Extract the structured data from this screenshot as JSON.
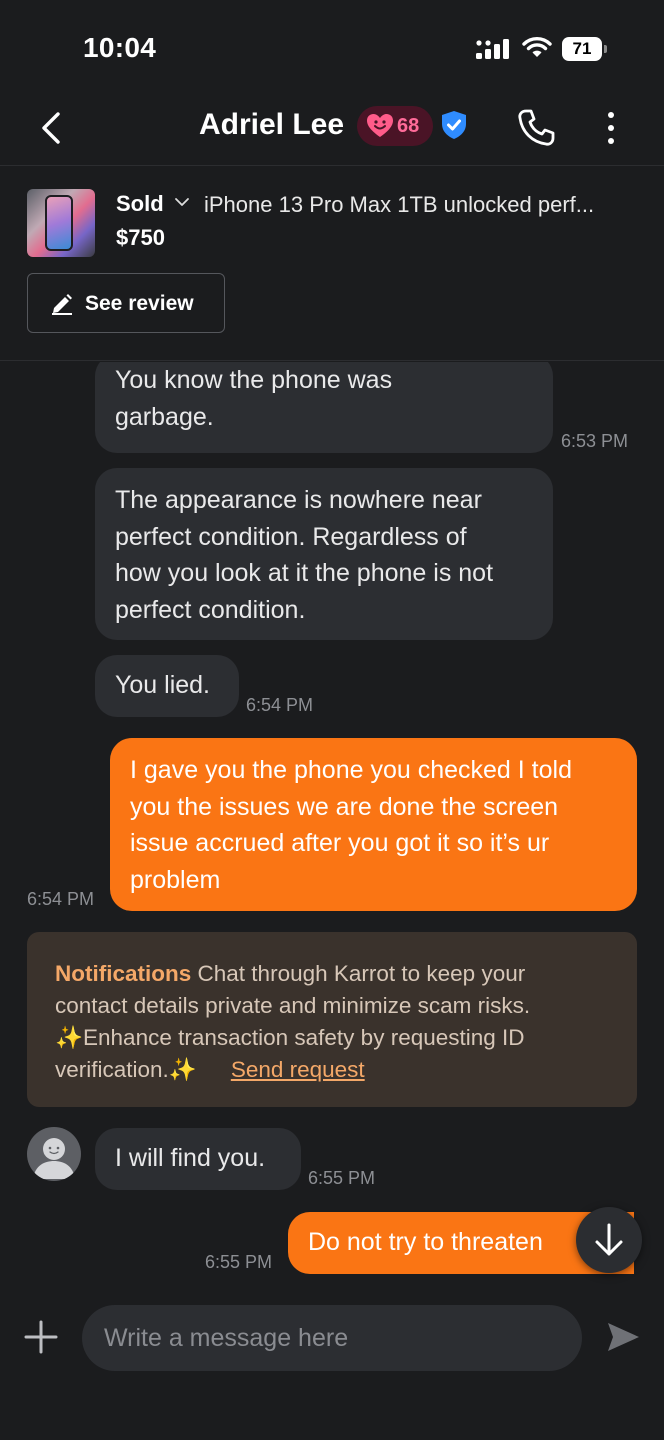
{
  "status_bar": {
    "time": "10:04",
    "battery": "71"
  },
  "header": {
    "title": "Adriel Lee",
    "manner_temp": "68"
  },
  "product": {
    "status": "Sold",
    "title": "iPhone 13 Pro Max 1TB unlocked perf...",
    "price": "$750",
    "review_button": "See review"
  },
  "messages": [
    {
      "side": "in",
      "text_lines": [
        "You know the phone was",
        "garbage."
      ],
      "time": "6:53 PM"
    },
    {
      "side": "in",
      "text_lines": [
        "The appearance is nowhere near",
        "perfect condition. Regardless of",
        "how you look at it the phone is not",
        "perfect condition."
      ]
    },
    {
      "side": "in",
      "text_lines": [
        "You lied."
      ],
      "time": "6:54 PM"
    },
    {
      "side": "out",
      "text_lines": [
        "I gave you the phone you checked I told",
        "you the issues we are done the screen",
        "issue accrued after you got it so it’s ur",
        "problem"
      ],
      "time": "6:54 PM"
    },
    {
      "side": "in",
      "text_lines": [
        "I will find you."
      ],
      "time": "6:55 PM"
    },
    {
      "side": "out",
      "text_lines": [
        "Do not try to threaten"
      ],
      "time": "6:55 PM"
    }
  ],
  "notice": {
    "heading": "Notifications",
    "line1": "Chat through Karrot to keep your",
    "line2": "contact details private and minimize scam risks.",
    "line3": "✨Enhance transaction safety by requesting ID",
    "line4": "verification.✨",
    "link": "Send request"
  },
  "composer": {
    "placeholder": "Write a message here"
  },
  "colors": {
    "background": "#1b1c1e",
    "incoming_bubble": "#2c2e32",
    "outgoing_bubble": "#fa7514",
    "notice_bg": "#3a322c",
    "notice_accent": "#f4a868",
    "manner_badge": "#4a1426",
    "verified": "#2f8cff"
  },
  "icons": [
    "back-icon",
    "heart-face-icon",
    "verified-check-icon",
    "phone-icon",
    "more-vertical-icon",
    "chevron-down-icon",
    "pencil-icon",
    "plus-icon",
    "send-icon",
    "arrow-down-icon",
    "default-avatar-icon"
  ]
}
